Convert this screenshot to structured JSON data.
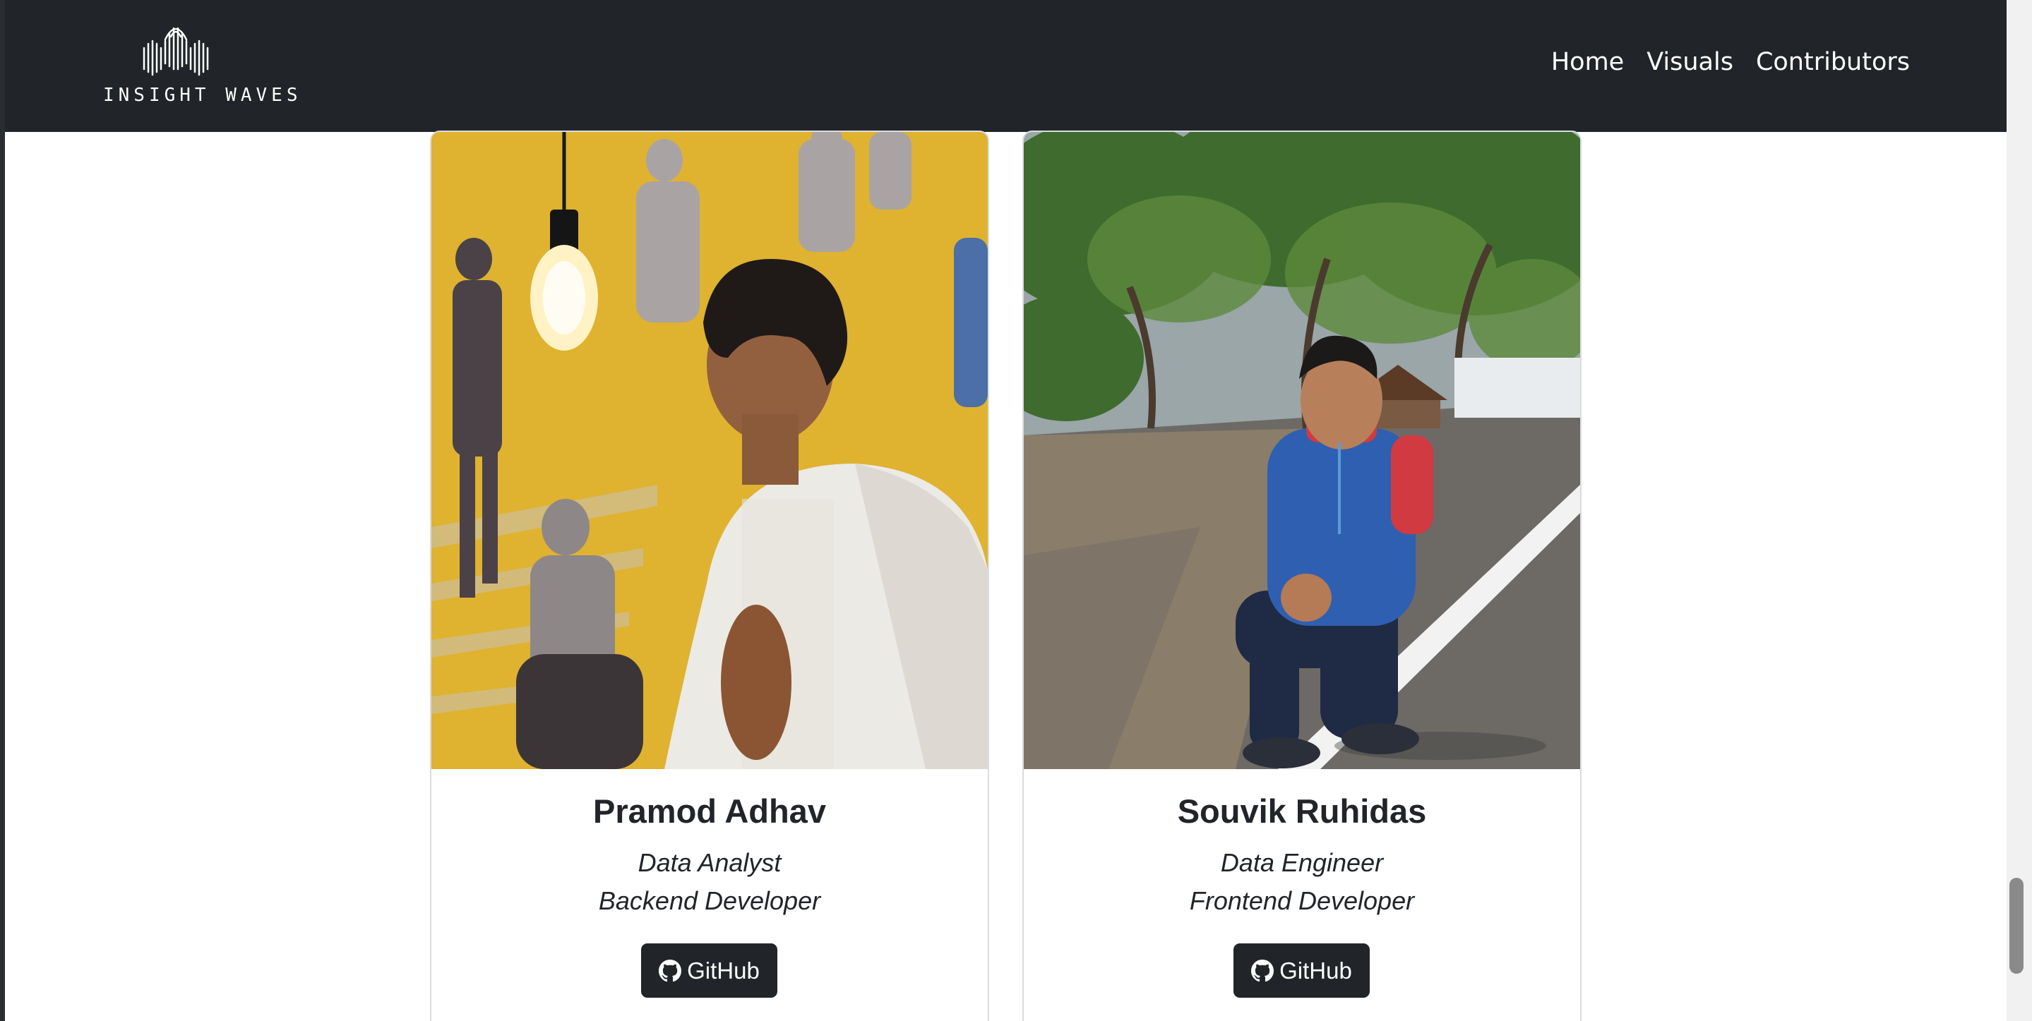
{
  "brand": {
    "name": "INSIGHT WAVES"
  },
  "nav": {
    "items": [
      {
        "label": "Home"
      },
      {
        "label": "Visuals"
      },
      {
        "label": "Contributors"
      }
    ]
  },
  "contributors": [
    {
      "name": "Pramod Adhav",
      "roles": [
        "Data Analyst",
        "Backend Developer"
      ],
      "github_label": "GitHub",
      "icon": "github-icon"
    },
    {
      "name": "Souvik Ruhidas",
      "roles": [
        "Data Engineer",
        "Frontend Developer"
      ],
      "github_label": "GitHub",
      "icon": "github-icon"
    }
  ],
  "colors": {
    "navbar_bg": "#212529",
    "button_bg": "#212529",
    "text": "#212529"
  }
}
